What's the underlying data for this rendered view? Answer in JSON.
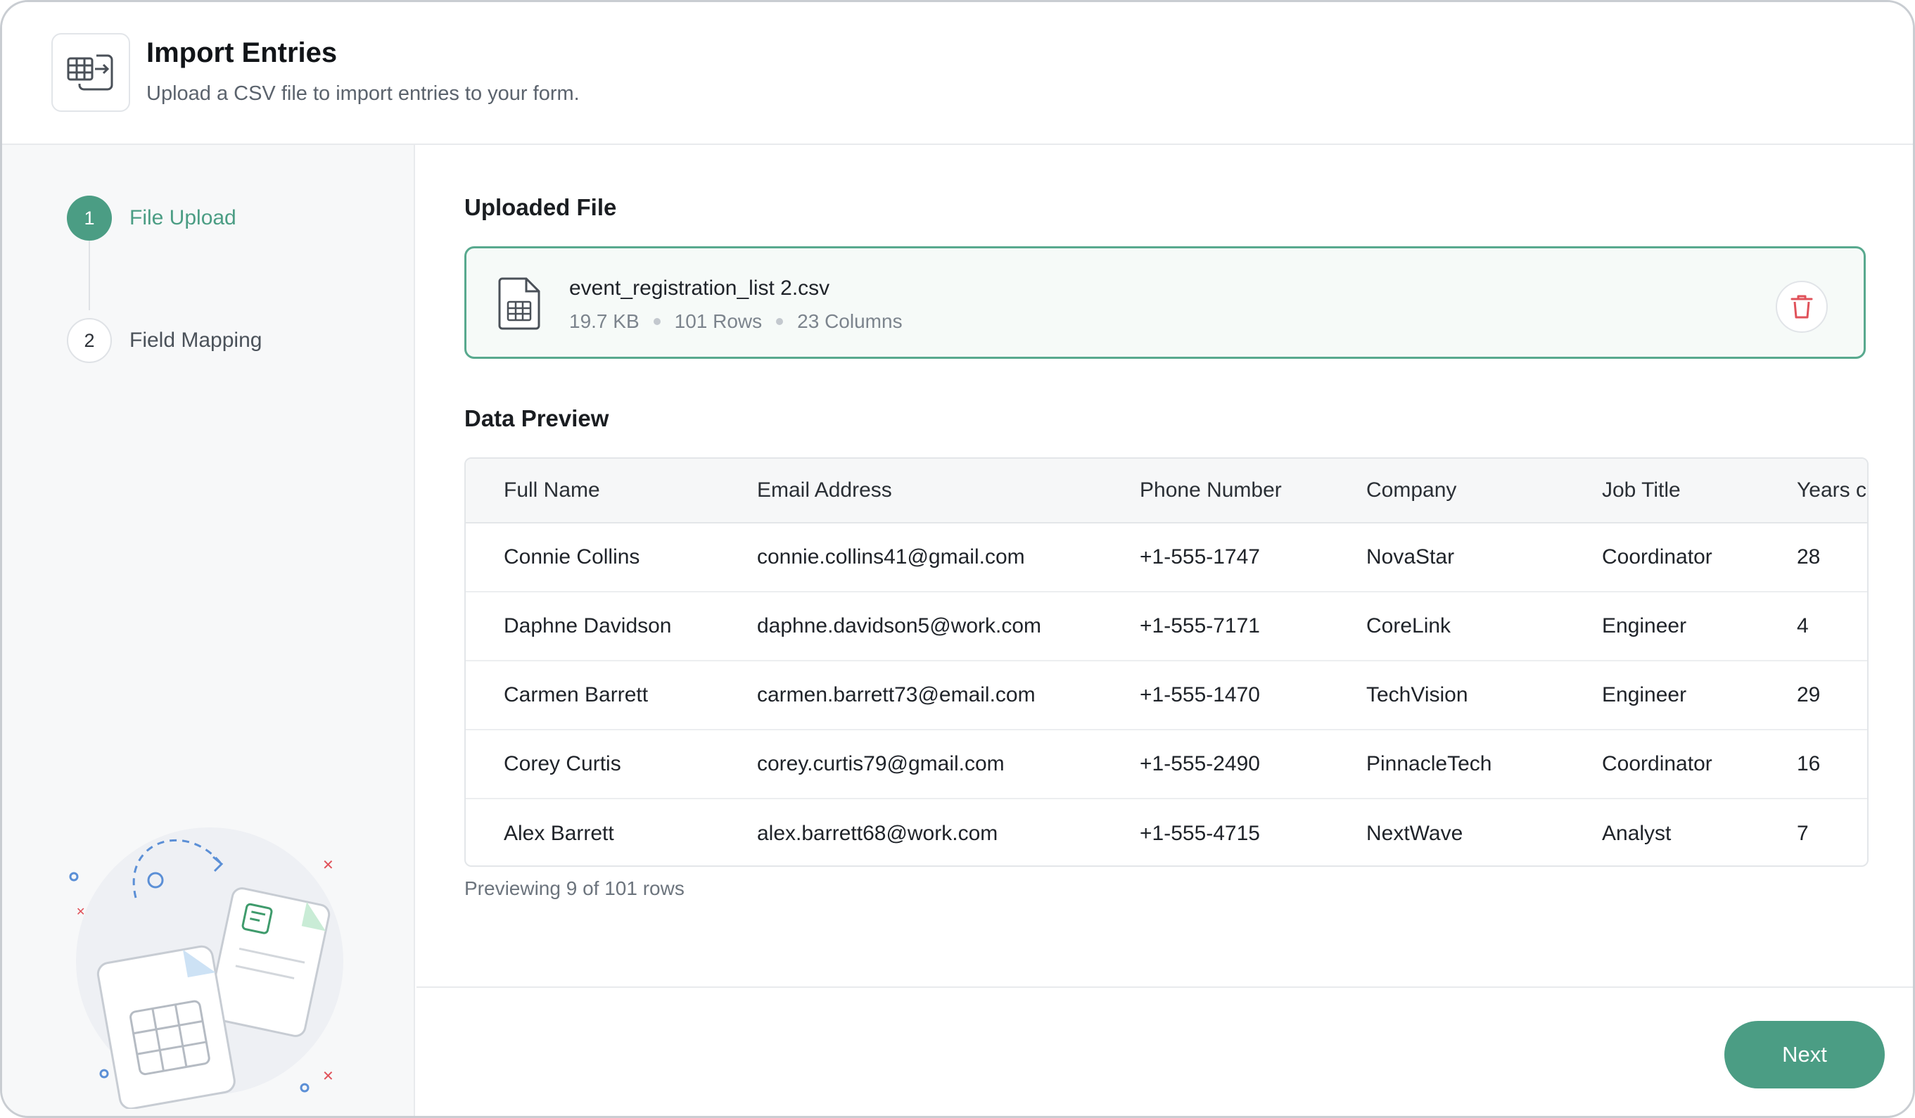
{
  "header": {
    "title": "Import Entries",
    "subtitle": "Upload a CSV file to import entries to your form.",
    "icon": "table-import-icon"
  },
  "steps": [
    {
      "number": "1",
      "label": "File Upload",
      "state": "active"
    },
    {
      "number": "2",
      "label": "Field Mapping",
      "state": "inactive"
    }
  ],
  "uploaded": {
    "section_title": "Uploaded File",
    "file_name": "event_registration_list 2.csv",
    "size": "19.7 KB",
    "rows": "101 Rows",
    "columns": "23 Columns",
    "file_icon": "spreadsheet-file-icon",
    "delete_icon": "trash-icon"
  },
  "preview": {
    "section_title": "Data Preview",
    "headers": [
      "Full Name",
      "Email Address",
      "Phone Number",
      "Company",
      "Job Title",
      "Years c"
    ],
    "rows": [
      [
        "Connie Collins",
        "connie.collins41@gmail.com",
        "+1-555-1747",
        "NovaStar",
        "Coordinator",
        "28"
      ],
      [
        "Daphne Davidson",
        "daphne.davidson5@work.com",
        "+1-555-7171",
        "CoreLink",
        "Engineer",
        "4"
      ],
      [
        "Carmen Barrett",
        "carmen.barrett73@email.com",
        "+1-555-1470",
        "TechVision",
        "Engineer",
        "29"
      ],
      [
        "Corey Curtis",
        "corey.curtis79@gmail.com",
        "+1-555-2490",
        "PinnacleTech",
        "Coordinator",
        "16"
      ],
      [
        "Alex Barrett",
        "alex.barrett68@work.com",
        "+1-555-4715",
        "NextWave",
        "Analyst",
        "7"
      ]
    ],
    "note": "Previewing 9 of 101 rows"
  },
  "footer": {
    "next_label": "Next"
  },
  "colors": {
    "accent": "#4b9d84",
    "danger": "#e0525a",
    "border": "#e8eaed"
  }
}
